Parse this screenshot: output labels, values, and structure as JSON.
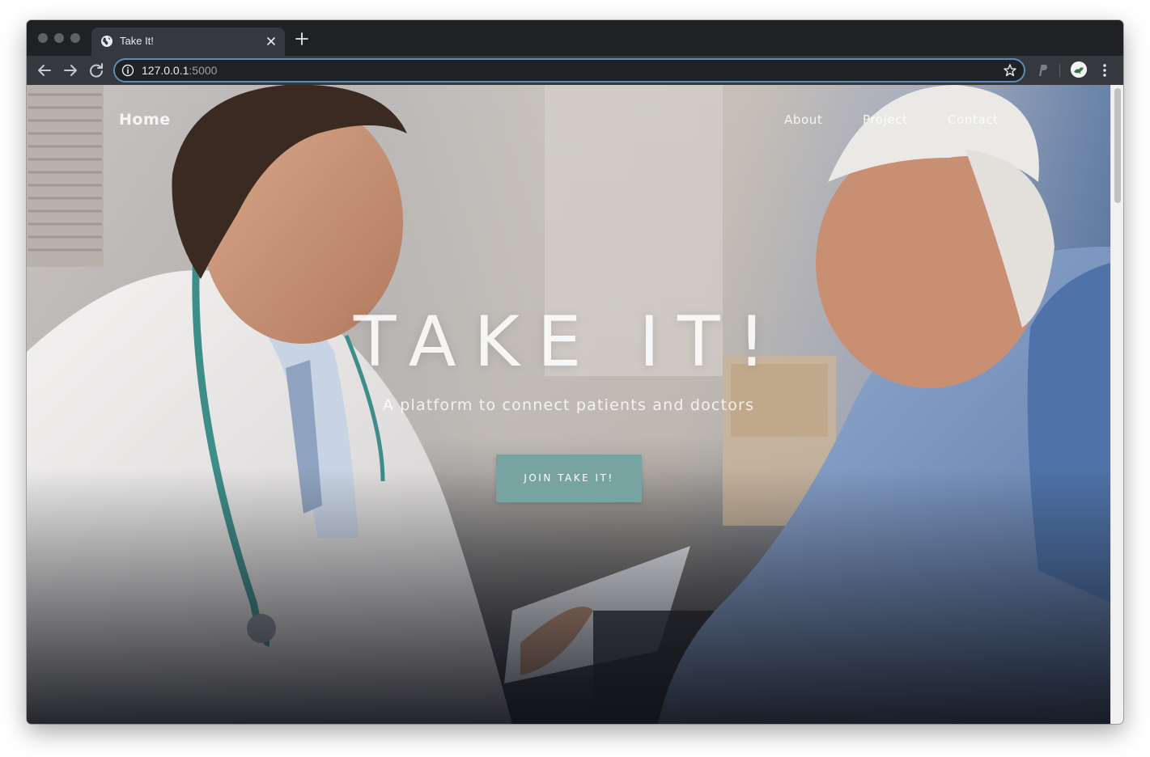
{
  "browser": {
    "tab": {
      "title": "Take It!"
    },
    "address": {
      "host": "127.0.0.1",
      "port": ":5000"
    }
  },
  "site": {
    "brand": "Home",
    "nav": [
      {
        "label": "About"
      },
      {
        "label": "Project"
      },
      {
        "label": "Contact"
      }
    ],
    "hero": {
      "title": "TAKE IT!",
      "subtitle": "A platform to connect patients and doctors",
      "cta_label": "JOIN TAKE IT!"
    }
  },
  "colors": {
    "cta": "#77a3a1",
    "chrome_dark": "#202124",
    "chrome_toolbar": "#35393e"
  },
  "icons": [
    "globe-icon",
    "close-icon",
    "plus-icon",
    "back-arrow-icon",
    "forward-arrow-icon",
    "reload-icon",
    "info-icon",
    "star-icon",
    "extension-p-icon",
    "profile-avatar",
    "kebab-menu-icon"
  ]
}
